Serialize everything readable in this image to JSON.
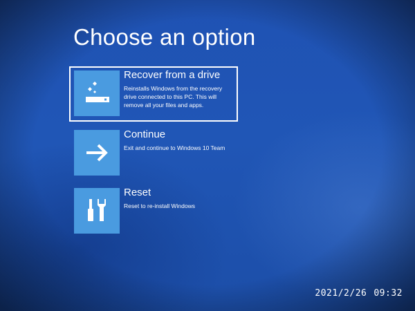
{
  "screen": {
    "title": "Choose an option"
  },
  "options": [
    {
      "title": "Recover from a drive",
      "description": "Reinstalls Windows from the recovery drive connected to this PC. This will remove all your files and apps.",
      "icon": "recovery-drive-icon",
      "selected": true
    },
    {
      "title": "Continue",
      "description": "Exit and continue to Windows 10 Team",
      "icon": "arrow-right-icon",
      "selected": false
    },
    {
      "title": "Reset",
      "description": "Reset to re-install Windows",
      "icon": "tools-icon",
      "selected": false
    }
  ],
  "camera_stamp": {
    "date": "2021/2/26",
    "time": "09:32"
  },
  "colors": {
    "background": "#2056b6",
    "tile": "#4a9be0",
    "text": "#ffffff"
  }
}
